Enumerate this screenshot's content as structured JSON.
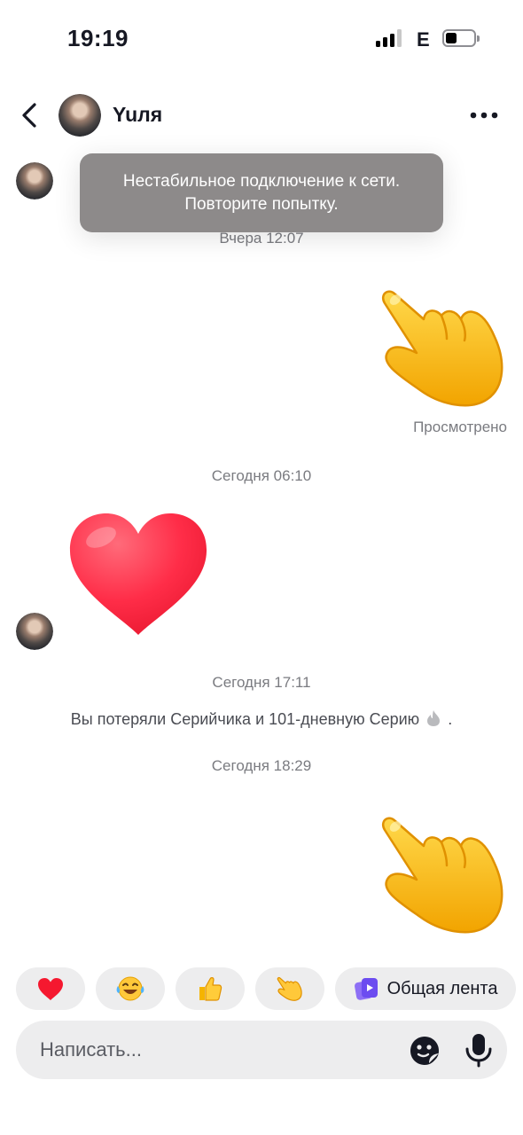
{
  "status_bar": {
    "time": "19:19",
    "network": "E",
    "signal_bars": 3,
    "battery_level": 0.3
  },
  "header": {
    "contact_name": "Yuля",
    "back_icon": "chevron-left-icon",
    "more_icon": "more-horizontal-icon"
  },
  "toast": {
    "line1": "Нестабильное подключение к сети.",
    "line2": "Повторите попытку."
  },
  "messages": {
    "ts1": "Вчера 12:07",
    "sticker1": "pointing-hand-emoji",
    "seen_label": "Просмотрено",
    "ts2": "Сегодня 06:10",
    "sticker2": "red-heart-emoji",
    "ts3": "Сегодня 17:11",
    "system_text": "Вы потеряли Серийчика и 101-дневную Серию",
    "system_suffix": ".",
    "ts4": "Сегодня 18:29",
    "sticker3": "pointing-hand-emoji"
  },
  "quick_reactions": {
    "items": [
      "heart-emoji",
      "tears-of-joy-emoji",
      "thumbs-up-emoji",
      "pointing-hand-emoji"
    ],
    "shared_feed_label": "Общая лента"
  },
  "composer": {
    "placeholder": "Написать..."
  },
  "colors": {
    "toast_bg": "#8d8a8a",
    "chip_bg": "#ededee",
    "text_secondary": "#7a7b80",
    "feed_icon": "#6c4cf0"
  }
}
